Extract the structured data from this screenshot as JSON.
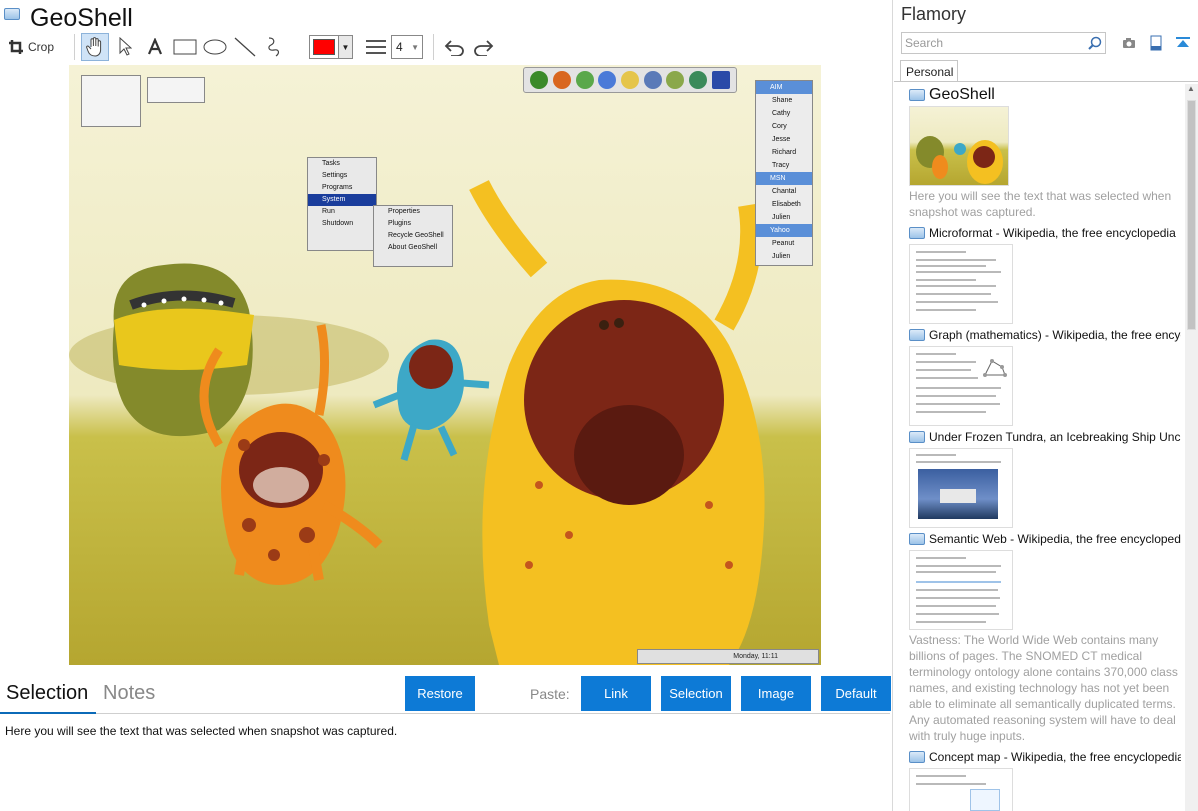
{
  "app": {
    "title": "GeoShell",
    "toolbar": {
      "crop_label": "Crop",
      "line_width": "4",
      "color": "#ff0000"
    }
  },
  "screenshot": {
    "start_menu": [
      "Tasks",
      "Settings",
      "Programs",
      "System",
      "Run",
      "Shutdown"
    ],
    "sub_menu": [
      "Properties",
      "Plugins",
      "Recycle GeoShell",
      "About GeoShell"
    ],
    "im_list": [
      {
        "group": "AIM",
        "names": [
          "Shane",
          "Cathy",
          "Cory",
          "Jesse",
          "Richard",
          "Tracy"
        ]
      },
      {
        "group": "MSN",
        "names": [
          "Chantal",
          "Elisabeth",
          "Julien"
        ]
      },
      {
        "group": "Yahoo",
        "names": [
          "Peanut",
          "Julien"
        ]
      }
    ],
    "taskbar_time": "Monday, 11:11"
  },
  "lower": {
    "tabs": [
      "Selection",
      "Notes"
    ],
    "restore_label": "Restore",
    "paste_label": "Paste:",
    "paste_buttons": [
      "Link",
      "Selection",
      "Image",
      "Default"
    ],
    "selection_text": "Here you will see the text that was selected when snapshot was captured."
  },
  "sidebar": {
    "brand": "Flamory",
    "search_placeholder": "Search",
    "tab": "Personal",
    "items": [
      {
        "title": "GeoShell",
        "desc": "Here you will see the text that was selected when snapshot was captured."
      },
      {
        "title": "Microformat - Wikipedia, the free encyclopedia"
      },
      {
        "title": "Graph (mathematics) - Wikipedia, the free encyc"
      },
      {
        "title": "Under Frozen Tundra, an Icebreaking Ship Unco"
      },
      {
        "title": "Semantic Web - Wikipedia, the free encycloped",
        "desc": "Vastness: The World Wide Web contains many billions of pages. The SNOMED CT medical terminology ontology alone contains 370,000 class names, and existing technology has not yet been able to eliminate all semantically duplicated terms. Any automated reasoning system will have to deal with truly huge inputs."
      },
      {
        "title": "Concept map - Wikipedia, the free encyclopedia"
      }
    ]
  },
  "colors": {
    "accent": "#0d7ad6",
    "tab_underline": "#0b6ab8"
  }
}
